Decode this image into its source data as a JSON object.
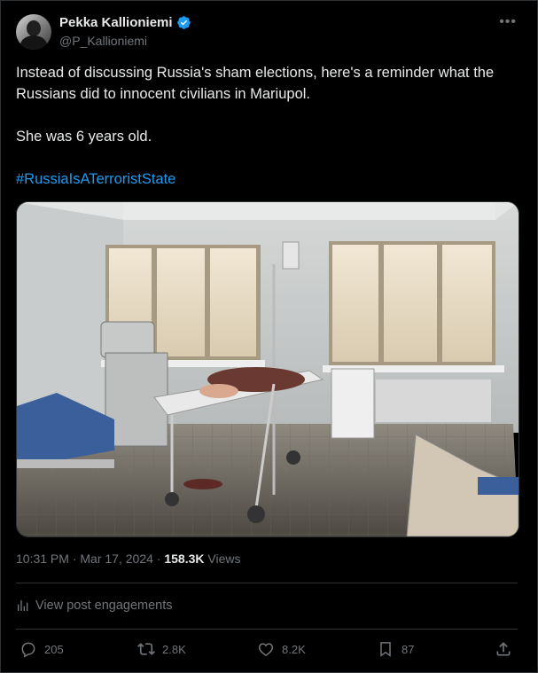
{
  "author": {
    "name": "Pekka Kallioniemi",
    "handle": "@P_Kallioniemi",
    "verified": true
  },
  "tweet": {
    "line1": "Instead of discussing Russia's sham elections, here's a reminder what the Russians did to innocent civilians in Mariupol.",
    "line2": "She was 6 years old.",
    "hashtag": "#RussiaIsATerroristState"
  },
  "meta": {
    "time": "10:31 PM",
    "separator": "·",
    "date": "Mar 17, 2024",
    "views_count": "158.3K",
    "views_label": "Views"
  },
  "engagements_label": "View post engagements",
  "actions": {
    "replies": "205",
    "reposts": "2.8K",
    "likes": "8.2K",
    "bookmarks": "87"
  },
  "colors": {
    "background": "#000000",
    "text": "#e7e9ea",
    "muted": "#71767b",
    "link": "#1d9bf0",
    "border": "#2f3336"
  }
}
